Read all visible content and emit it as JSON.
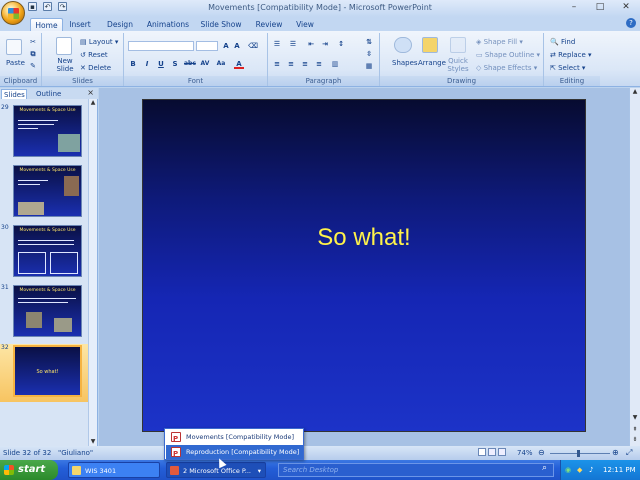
{
  "window": {
    "title": "Movements [Compatibility Mode] - Microsoft PowerPoint"
  },
  "quick_access": [
    "save-icon",
    "undo-icon",
    "redo-icon"
  ],
  "tabs": [
    "Home",
    "Insert",
    "Design",
    "Animations",
    "Slide Show",
    "Review",
    "View"
  ],
  "active_tab": "Home",
  "ribbon": {
    "clipboard": {
      "label": "Clipboard",
      "paste": "Paste"
    },
    "slides": {
      "label": "Slides",
      "new_slide": "New Slide",
      "layout": "Layout",
      "reset": "Reset",
      "delete": "Delete"
    },
    "font": {
      "label": "Font",
      "buttons": [
        "B",
        "I",
        "U",
        "S",
        "abc",
        "AV",
        "Aa",
        "A"
      ]
    },
    "paragraph": {
      "label": "Paragraph"
    },
    "drawing": {
      "label": "Drawing",
      "shapes": "Shapes",
      "arrange": "Arrange",
      "quick_styles": "Quick Styles",
      "shape_fill": "Shape Fill",
      "shape_outline": "Shape Outline",
      "shape_effects": "Shape Effects"
    },
    "editing": {
      "label": "Editing",
      "find": "Find",
      "replace": "Replace",
      "select": "Select"
    }
  },
  "pane_tabs": [
    "Slides",
    "Outline"
  ],
  "thumbnails": [
    {
      "number": "29",
      "title": "Movements & Space Use"
    },
    {
      "number": "",
      "title": "Movements & Space Use"
    },
    {
      "number": "30",
      "title": "Movements & Space Use"
    },
    {
      "number": "31",
      "title": "Movements & Space Use"
    },
    {
      "number": "32",
      "title": "So what!"
    }
  ],
  "slide": {
    "text": "So what!"
  },
  "status": {
    "slide": "Slide 32 of 32",
    "theme": "\"Giuliano\"",
    "zoom": "74%"
  },
  "popup": {
    "items": [
      "Movements [Compatibility Mode]",
      "Reproduction [Compatibility Mode]"
    ]
  },
  "taskbar": {
    "start": "start",
    "items": [
      "WIS 3401",
      "2 Microsoft Office P..."
    ],
    "search_placeholder": "Search Desktop",
    "clock": "12:11 PM"
  },
  "colors": {
    "slide_text": "#fff24a",
    "slide_bg": "#1526b4",
    "selected_thumb": "#f5b342"
  }
}
